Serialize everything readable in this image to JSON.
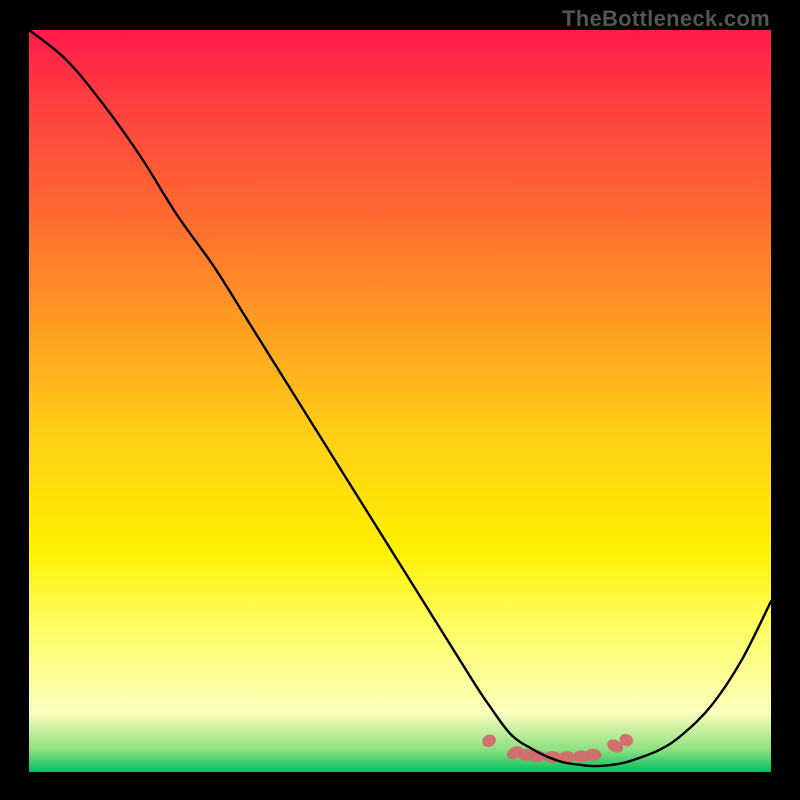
{
  "watermark": "TheBottleneck.com",
  "chart_data": {
    "type": "line",
    "title": "",
    "xlabel": "",
    "ylabel": "",
    "xlim": [
      0,
      100
    ],
    "ylim": [
      0,
      100
    ],
    "background_gradient": {
      "top": "#ff1a49",
      "mid_upper": "#ff6a30",
      "mid": "#ffd015",
      "mid_lower": "#fdfd60",
      "bottom": "#00c060"
    },
    "series": [
      {
        "name": "curve",
        "color": "#000000",
        "x": [
          0,
          5,
          10,
          15,
          20,
          25,
          30,
          35,
          40,
          45,
          50,
          55,
          60,
          62,
          65,
          68,
          70,
          72,
          74,
          76,
          78,
          80,
          82,
          85,
          88,
          92,
          96,
          100
        ],
        "y": [
          100,
          96,
          90,
          83,
          75,
          68,
          60,
          52,
          44,
          36,
          28,
          20,
          12,
          9,
          5,
          3,
          2,
          1.3,
          1.0,
          0.8,
          0.9,
          1.2,
          1.8,
          3.0,
          5.0,
          9.0,
          15,
          23
        ]
      }
    ],
    "markers": {
      "name": "highlight-dots",
      "color": "#d46a6a",
      "points": [
        {
          "x": 62.0,
          "y": 4.2
        },
        {
          "x": 65.5,
          "y": 2.6
        },
        {
          "x": 67.0,
          "y": 2.3
        },
        {
          "x": 68.5,
          "y": 2.1
        },
        {
          "x": 70.5,
          "y": 2.0
        },
        {
          "x": 72.5,
          "y": 2.0
        },
        {
          "x": 74.5,
          "y": 2.1
        },
        {
          "x": 76.0,
          "y": 2.3
        },
        {
          "x": 79.0,
          "y": 3.5
        },
        {
          "x": 80.5,
          "y": 4.3
        }
      ]
    }
  }
}
